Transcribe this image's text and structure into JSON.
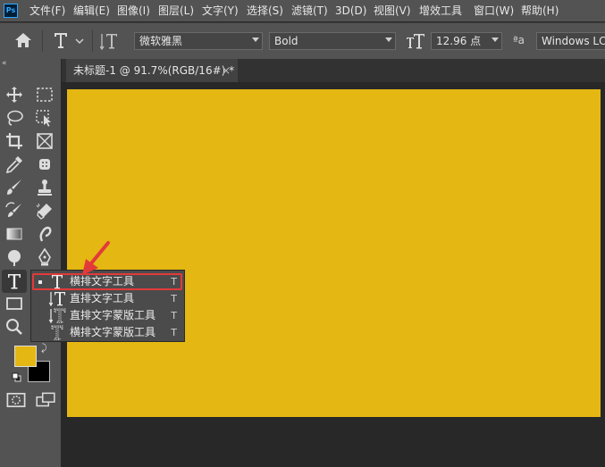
{
  "app": {
    "logo_text": "Ps"
  },
  "menu": [
    {
      "label": "文件(F)"
    },
    {
      "label": "编辑(E)"
    },
    {
      "label": "图像(I)"
    },
    {
      "label": "图层(L)"
    },
    {
      "label": "文字(Y)"
    },
    {
      "label": "选择(S)"
    },
    {
      "label": "滤镜(T)"
    },
    {
      "label": "3D(D)"
    },
    {
      "label": "视图(V)"
    },
    {
      "label": "增效工具"
    },
    {
      "label": "窗口(W)"
    },
    {
      "label": "帮助(H)"
    }
  ],
  "options": {
    "font_family": "微软雅黑",
    "font_style": "Bold",
    "font_size": "12.96 点",
    "antialias": "Windows LCD"
  },
  "document_tab": {
    "title": "未标题-1 @ 91.7%(RGB/16#) *",
    "close": "×"
  },
  "colors": {
    "foreground": "#e4b712",
    "background": "#000000",
    "canvas": "#e4b712",
    "highlight": "#e23a3a"
  },
  "flyout": {
    "items": [
      {
        "label": "横排文字工具",
        "shortcut": "T",
        "icon": "horizontal-type-icon",
        "active": true
      },
      {
        "label": "直排文字工具",
        "shortcut": "T",
        "icon": "vertical-type-icon",
        "active": false
      },
      {
        "label": "直排文字蒙版工具",
        "shortcut": "T",
        "icon": "vertical-type-mask-icon",
        "active": false
      },
      {
        "label": "横排文字蒙版工具",
        "shortcut": "T",
        "icon": "horizontal-type-mask-icon",
        "active": false
      }
    ]
  }
}
